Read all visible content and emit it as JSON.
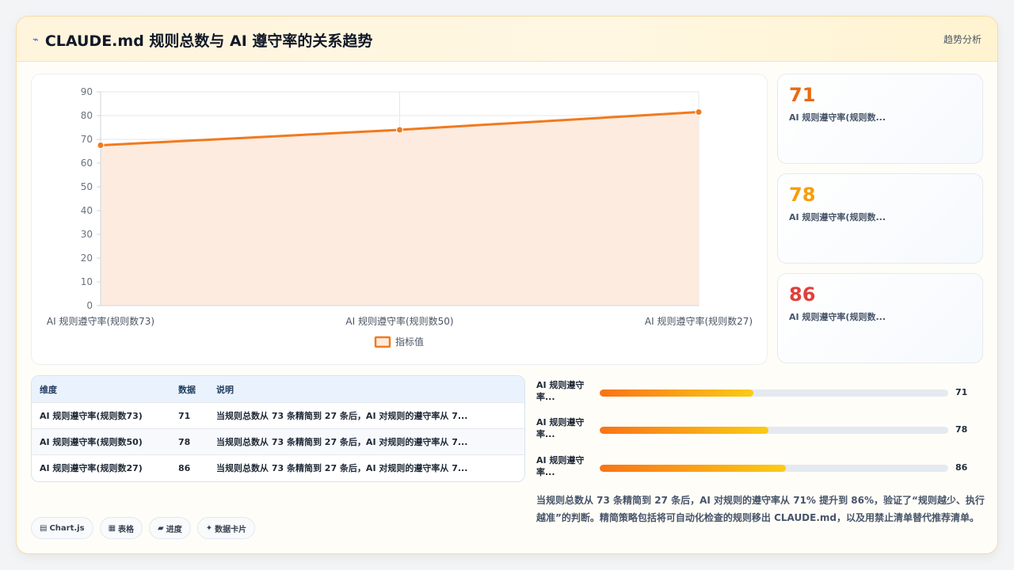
{
  "header": {
    "icon": "chart-line-icon",
    "title": "CLAUDE.md 规则总数与 AI 遵守率的关系趋势",
    "link_label": "趋势分析"
  },
  "chart_data": {
    "type": "area",
    "categories": [
      "AI 规则遵守率(规则数73)",
      "AI 规则遵守率(规则数50)",
      "AI 规则遵守率(规则数27)"
    ],
    "series": [
      {
        "name": "指标值",
        "values": [
          67.5,
          74,
          81.5
        ]
      }
    ],
    "ylim": [
      0,
      90
    ],
    "yticks": [
      0,
      10,
      20,
      30,
      40,
      50,
      60,
      70,
      80,
      90
    ],
    "grid": true,
    "legend": "bottom",
    "color": "#f07a1f",
    "fill": "#fdebdf"
  },
  "stats": [
    {
      "value": "71",
      "label": "AI 规则遵守率(规则数...",
      "color": "#ea6a10"
    },
    {
      "value": "78",
      "label": "AI 规则遵守率(规则数...",
      "color": "#f59e0b"
    },
    {
      "value": "86",
      "label": "AI 规则遵守率(规则数...",
      "color": "#e0403c"
    }
  ],
  "table": {
    "headers": [
      "维度",
      "数据",
      "说明"
    ],
    "rows": [
      [
        "AI 规则遵守率(规则数73)",
        "71",
        "当规则总数从 73 条精简到 27 条后，AI 对规则的遵守率从 7..."
      ],
      [
        "AI 规则遵守率(规则数50)",
        "78",
        "当规则总数从 73 条精简到 27 条后，AI 对规则的遵守率从 7..."
      ],
      [
        "AI 规则遵守率(规则数27)",
        "86",
        "当规则总数从 73 条精简到 27 条后，AI 对规则的遵守率从 7..."
      ]
    ]
  },
  "progress": [
    {
      "label": "AI 规则遵守率...",
      "value": "71",
      "fraction": 0.44
    },
    {
      "label": "AI 规则遵守率...",
      "value": "78",
      "fraction": 0.485
    },
    {
      "label": "AI 规则遵守率...",
      "value": "86",
      "fraction": 0.535
    }
  ],
  "summary": "当规则总数从 73 条精简到 27 条后，AI 对规则的遵守率从 71% 提升到 86%，验证了“规则越少、执行越准”的判断。精简策略包括将可自动化检查的规则移出 CLAUDE.md，以及用禁止清单替代推荐清单。",
  "tags": [
    {
      "icon": "chart-icon",
      "glyph": "▤",
      "label": "Chart.js"
    },
    {
      "icon": "table-icon",
      "glyph": "▦",
      "label": "表格"
    },
    {
      "icon": "progress-icon",
      "glyph": "▰",
      "label": "进度"
    },
    {
      "icon": "sparkle-icon",
      "glyph": "✦",
      "label": "数据卡片"
    }
  ]
}
